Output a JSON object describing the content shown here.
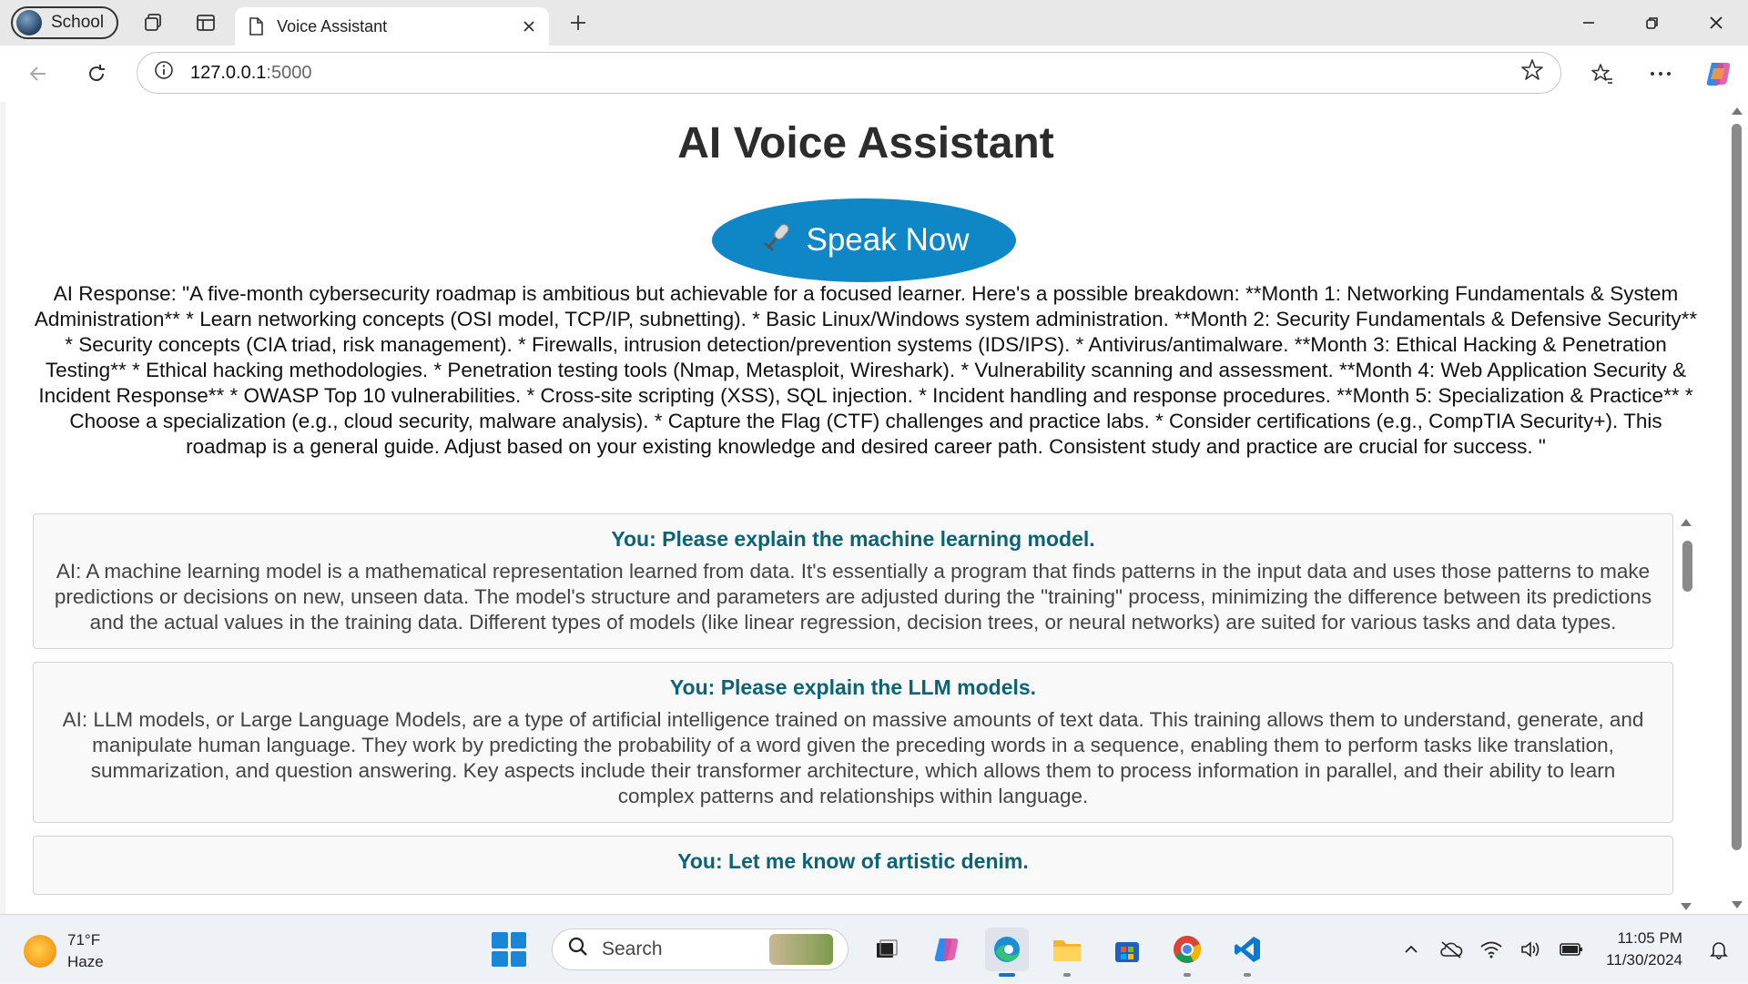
{
  "browser": {
    "profile_label": "School",
    "tab_title": "Voice Assistant",
    "url_host": "127.0.0.1",
    "url_port": ":5000"
  },
  "page": {
    "title": "AI Voice Assistant",
    "speak_button_label": "Speak Now",
    "ai_response": "AI Response: \"A five-month cybersecurity roadmap is ambitious but achievable for a focused learner. Here's a possible breakdown: **Month 1: Networking Fundamentals & System Administration** * Learn networking concepts (OSI model, TCP/IP, subnetting). * Basic Linux/Windows system administration. **Month 2: Security Fundamentals & Defensive Security** * Security concepts (CIA triad, risk management). * Firewalls, intrusion detection/prevention systems (IDS/IPS). * Antivirus/antimalware. **Month 3: Ethical Hacking & Penetration Testing** * Ethical hacking methodologies. * Penetration testing tools (Nmap, Metasploit, Wireshark). * Vulnerability scanning and assessment. **Month 4: Web Application Security & Incident Response** * OWASP Top 10 vulnerabilities. * Cross-site scripting (XSS), SQL injection. * Incident handling and response procedures. **Month 5: Specialization & Practice** * Choose a specialization (e.g., cloud security, malware analysis). * Capture the Flag (CTF) challenges and practice labs. * Consider certifications (e.g., CompTIA Security+). This roadmap is a general guide. Adjust based on your existing knowledge and desired career path. Consistent study and practice are crucial for success. \"",
    "conversation": [
      {
        "question": "You: Please explain the machine learning model.",
        "answer": "AI: A machine learning model is a mathematical representation learned from data. It's essentially a program that finds patterns in the input data and uses those patterns to make predictions or decisions on new, unseen data. The model's structure and parameters are adjusted during the \"training\" process, minimizing the difference between its predictions and the actual values in the training data. Different types of models (like linear regression, decision trees, or neural networks) are suited for various tasks and data types."
      },
      {
        "question": "You: Please explain the LLM models.",
        "answer": "AI: LLM models, or Large Language Models, are a type of artificial intelligence trained on massive amounts of text data. This training allows them to understand, generate, and manipulate human language. They work by predicting the probability of a word given the preceding words in a sequence, enabling them to perform tasks like translation, summarization, and question answering. Key aspects include their transformer architecture, which allows them to process information in parallel, and their ability to learn complex patterns and relationships within language."
      },
      {
        "question": "You: Let me know of artistic denim.",
        "answer": ""
      }
    ]
  },
  "taskbar": {
    "weather_temp": "71°F",
    "weather_desc": "Haze",
    "search_label": "Search",
    "time": "11:05 PM",
    "date": "11/30/2024"
  },
  "colors": {
    "speak_button": "#0f86c6",
    "question_text": "#0b6374",
    "title_text": "#2c2c2c"
  },
  "icons": [
    "avatar",
    "workspaces-icon",
    "tab-actions-icon",
    "page-icon",
    "close-icon",
    "plus-icon",
    "minimize-icon",
    "restore-icon",
    "window-close-icon",
    "back-icon",
    "refresh-icon",
    "info-icon",
    "star-icon",
    "favorites-icon",
    "more-icon",
    "copilot-icon",
    "microphone-icon",
    "windows-start-icon",
    "search-icon",
    "file-explorer-icon",
    "edge-icon",
    "store-icon",
    "chrome-icon",
    "vscode-icon",
    "wifi-icon",
    "volume-icon",
    "battery-icon",
    "bell-icon"
  ]
}
